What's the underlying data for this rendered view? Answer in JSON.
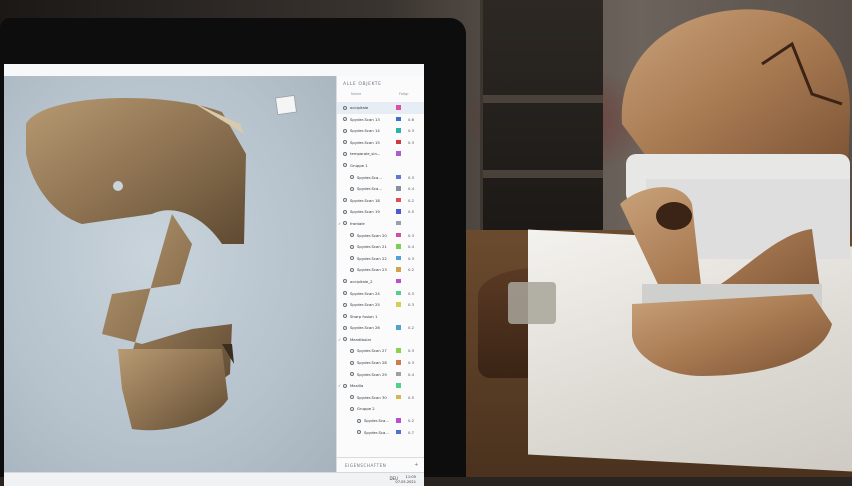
{
  "panel": {
    "title": "ALLE OBJEKTE",
    "col_name": "Name",
    "col_value": "Faltgr",
    "footer": "EIGENSCHAFTEN",
    "footer_icon": "+"
  },
  "layers": [
    {
      "name": "occipitale",
      "indent": 0,
      "check": false,
      "color": "#d94fa3",
      "value": ""
    },
    {
      "name": "Spyder-Scan 13",
      "indent": 0,
      "check": false,
      "color": "#3a6fd1",
      "value": "0.6"
    },
    {
      "name": "Spyder-Scan 14",
      "indent": 0,
      "check": false,
      "color": "#2bb3a6",
      "value": "0.3"
    },
    {
      "name": "Spyder-Scan 15",
      "indent": 0,
      "check": false,
      "color": "#d13a3a",
      "value": "0.3"
    },
    {
      "name": "temporale_sin...",
      "indent": 0,
      "check": false,
      "color": "#a65fd1",
      "value": ""
    },
    {
      "name": "Gruppe 1",
      "indent": 0,
      "check": false,
      "color": "",
      "value": ""
    },
    {
      "name": "Spyder-Sca...",
      "indent": 1,
      "check": false,
      "color": "#5a7bd9",
      "value": "0.3"
    },
    {
      "name": "Spyder-Sca...",
      "indent": 1,
      "check": false,
      "color": "#8a8fa0",
      "value": "0.4"
    },
    {
      "name": "Spyder-Scan 18",
      "indent": 0,
      "check": false,
      "color": "#d94f5a",
      "value": "0.2"
    },
    {
      "name": "Spyder-Scan 19",
      "indent": 0,
      "check": false,
      "color": "#4a5bd1",
      "value": "0.5"
    },
    {
      "name": "frontale",
      "indent": 0,
      "check": true,
      "color": "#9a9fb0",
      "value": ""
    },
    {
      "name": "Spyder-Scan 20",
      "indent": 1,
      "check": false,
      "color": "#d14fa3",
      "value": "0.3"
    },
    {
      "name": "Spyder-Scan 21",
      "indent": 1,
      "check": false,
      "color": "#7ad14f",
      "value": "0.4"
    },
    {
      "name": "Spyder-Scan 22",
      "indent": 1,
      "check": false,
      "color": "#4fa3d1",
      "value": "0.3"
    },
    {
      "name": "Spyder-Scan 23",
      "indent": 1,
      "check": false,
      "color": "#d1a34f",
      "value": "0.2"
    },
    {
      "name": "occipitale_2",
      "indent": 0,
      "check": false,
      "color": "#b84fd1",
      "value": ""
    },
    {
      "name": "Spyder-Scan 24",
      "indent": 0,
      "check": false,
      "color": "#4fd18a",
      "value": "0.3"
    },
    {
      "name": "Spyder-Scan 25",
      "indent": 0,
      "check": false,
      "color": "#d1d14f",
      "value": "0.3"
    },
    {
      "name": "Sharp fusion 1",
      "indent": 0,
      "check": false,
      "color": "",
      "value": ""
    },
    {
      "name": "Spyder-Scan 26",
      "indent": 0,
      "check": false,
      "color": "#4fa3d1",
      "value": "0.2"
    },
    {
      "name": "Mandibular",
      "indent": 0,
      "check": true,
      "color": "",
      "value": ""
    },
    {
      "name": "Spyder-Scan 27",
      "indent": 1,
      "check": false,
      "color": "#8ad14f",
      "value": "0.3"
    },
    {
      "name": "Spyder-Scan 28",
      "indent": 1,
      "check": false,
      "color": "#d17a4f",
      "value": "0.3"
    },
    {
      "name": "Spyder-Scan 29",
      "indent": 1,
      "check": false,
      "color": "#a0a0a0",
      "value": "0.4"
    },
    {
      "name": "Maxilla",
      "indent": 0,
      "check": true,
      "color": "#4fd18a",
      "value": ""
    },
    {
      "name": "Spyder-Scan 30",
      "indent": 1,
      "check": false,
      "color": "#d1b84f",
      "value": "0.5"
    },
    {
      "name": "Gruppe 2",
      "indent": 1,
      "check": false,
      "color": "",
      "value": ""
    },
    {
      "name": "Spyder-Sca...",
      "indent": 2,
      "check": false,
      "color": "#b84fd1",
      "value": "0.2"
    },
    {
      "name": "Spyder-Sca...",
      "indent": 2,
      "check": false,
      "color": "#4f6fd1",
      "value": "0.7"
    }
  ],
  "taskbar": {
    "lang": "DEU",
    "time": "11:05",
    "date": "07.05.2021"
  }
}
